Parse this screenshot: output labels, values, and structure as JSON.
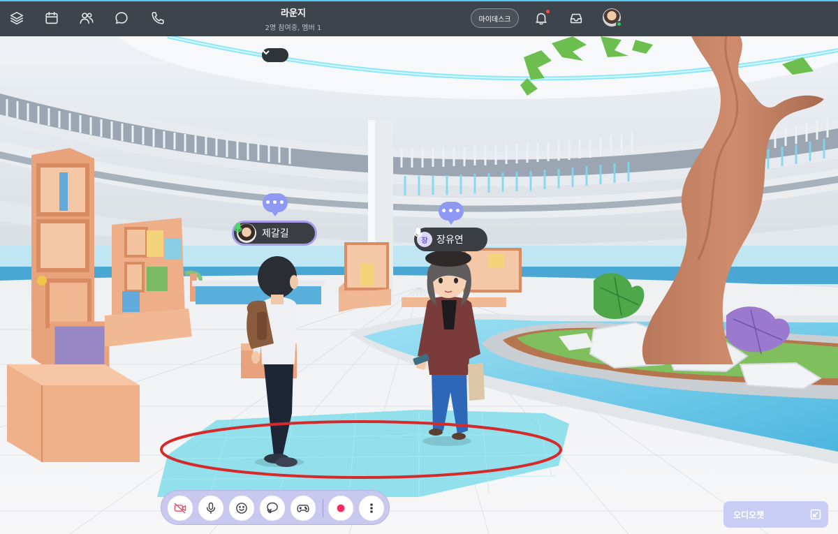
{
  "header": {
    "nav_icons": [
      "layers-icon",
      "calendar-icon",
      "people-icon",
      "chat-icon",
      "phone-icon"
    ],
    "room_title": "라운지",
    "room_subtitle": "2명 참여중, 멤버 1",
    "mydesk_label": "마이데스크",
    "right_icons": [
      "bell-icon",
      "inbox-icon"
    ],
    "notification_dot": true,
    "user_online": true
  },
  "scene": {
    "speech_bubble_text": "•••",
    "avatars": [
      {
        "name": "제갈길",
        "mic": "active",
        "speaking": true
      },
      {
        "name": "장유연",
        "initial": "장",
        "mic": "idle",
        "speaking": false
      }
    ]
  },
  "toolbar": {
    "buttons": [
      "camera-off-icon",
      "mic-icon",
      "emoji-icon",
      "gesture-icon",
      "game-icon",
      "record-icon",
      "more-icon"
    ]
  },
  "audio_chat": {
    "label": "오디오챗"
  },
  "colors": {
    "topbar": "#3e444b",
    "accent": "#8d99f2",
    "speaking_mic": "#4cd964",
    "record": "#ff2a5f",
    "floor_zone": "#7fdcea",
    "highlight_ring": "#d62a2a"
  }
}
